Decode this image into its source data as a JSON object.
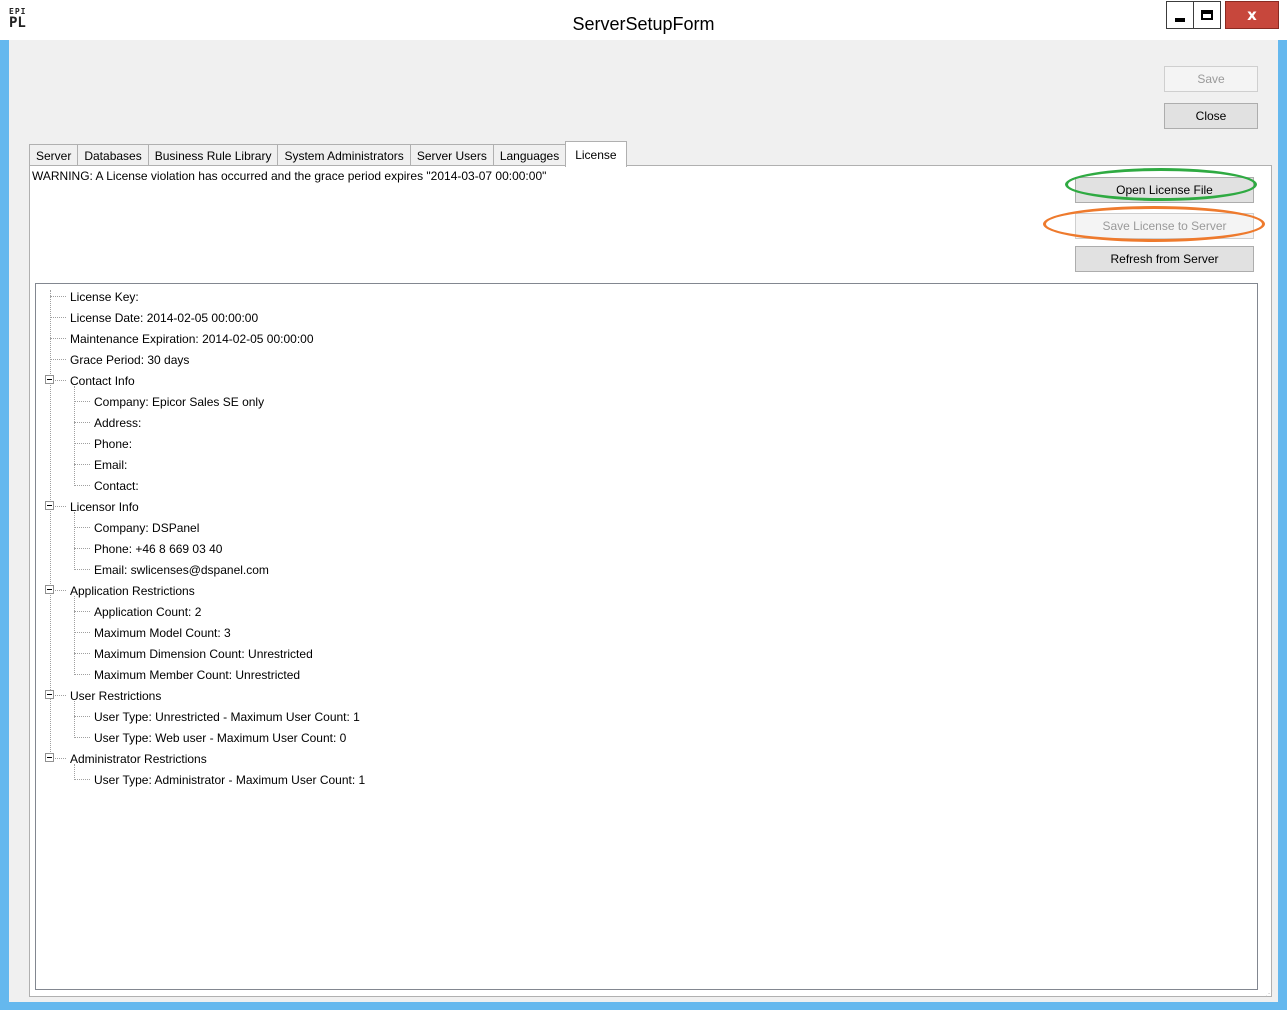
{
  "window": {
    "title": "ServerSetupForm",
    "logo_top": "EPI",
    "logo_bottom": "PL",
    "minimize_label": "",
    "close_glyph": "x"
  },
  "toolbar": {
    "save_label": "Save",
    "close_label": "Close"
  },
  "tabs": [
    {
      "label": "Server",
      "active": false
    },
    {
      "label": "Databases",
      "active": false
    },
    {
      "label": "Business Rule Library",
      "active": false
    },
    {
      "label": "System Administrators",
      "active": false
    },
    {
      "label": "Server Users",
      "active": false
    },
    {
      "label": "Languages",
      "active": false
    },
    {
      "label": "License",
      "active": true
    }
  ],
  "license": {
    "warning": "WARNING:  A License violation has occurred and the grace period expires \"2014-03-07 00:00:00\"",
    "open_label": "Open License File",
    "save_to_server_label": "Save License to Server",
    "refresh_label": "Refresh from Server"
  },
  "tree": [
    {
      "label": "License Key:",
      "level": 0,
      "expandable": false
    },
    {
      "label": "License Date: 2014-02-05 00:00:00",
      "level": 0,
      "expandable": false
    },
    {
      "label": "Maintenance Expiration: 2014-02-05 00:00:00",
      "level": 0,
      "expandable": false
    },
    {
      "label": "Grace Period: 30 days",
      "level": 0,
      "expandable": false
    },
    {
      "label": "Contact Info",
      "level": 0,
      "expandable": true
    },
    {
      "label": "Company: Epicor Sales SE only",
      "level": 1,
      "expandable": false
    },
    {
      "label": "Address:",
      "level": 1,
      "expandable": false
    },
    {
      "label": "Phone:",
      "level": 1,
      "expandable": false
    },
    {
      "label": "Email:",
      "level": 1,
      "expandable": false
    },
    {
      "label": "Contact:",
      "level": 1,
      "expandable": false
    },
    {
      "label": "Licensor Info",
      "level": 0,
      "expandable": true
    },
    {
      "label": "Company: DSPanel",
      "level": 1,
      "expandable": false
    },
    {
      "label": "Phone: +46 8 669 03 40",
      "level": 1,
      "expandable": false
    },
    {
      "label": "Email: swlicenses@dspanel.com",
      "level": 1,
      "expandable": false
    },
    {
      "label": "Application Restrictions",
      "level": 0,
      "expandable": true
    },
    {
      "label": "Application Count:  2",
      "level": 1,
      "expandable": false
    },
    {
      "label": "Maximum Model Count:  3",
      "level": 1,
      "expandable": false
    },
    {
      "label": "Maximum Dimension Count:  Unrestricted",
      "level": 1,
      "expandable": false
    },
    {
      "label": "Maximum Member Count:  Unrestricted",
      "level": 1,
      "expandable": false
    },
    {
      "label": "User Restrictions",
      "level": 0,
      "expandable": true
    },
    {
      "label": "User Type: Unrestricted - Maximum User Count: 1",
      "level": 1,
      "expandable": false
    },
    {
      "label": "User Type: Web user - Maximum User Count: 0",
      "level": 1,
      "expandable": false
    },
    {
      "label": "Administrator Restrictions",
      "level": 0,
      "expandable": true
    },
    {
      "label": "User Type: Administrator - Maximum User Count: 1",
      "level": 1,
      "expandable": false
    }
  ],
  "colors": {
    "highlight_open": "#2faa42",
    "highlight_save": "#ee7a2d",
    "window_border": "#65b8ee"
  }
}
